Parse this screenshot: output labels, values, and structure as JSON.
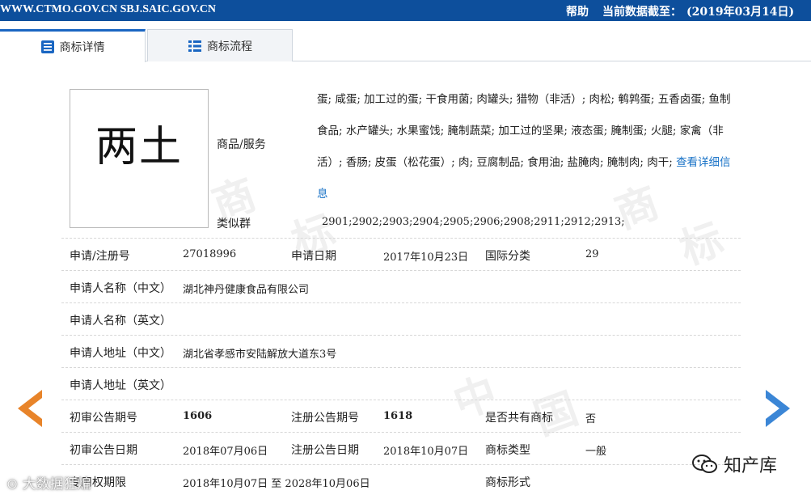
{
  "topbar": {
    "site": "WWW.CTMO.GOV.CN SBJ.SAIC.GOV.CN",
    "help": "帮助",
    "asof_label": "当前数据截至：",
    "asof_date": "(2019年03月14日)"
  },
  "tabs": [
    {
      "label": "商标详情",
      "icon": "document-icon",
      "active": true
    },
    {
      "label": "商标流程",
      "icon": "list-icon",
      "active": false
    }
  ],
  "trademark": {
    "logo_text": "两土",
    "goods_label": "商品/服务",
    "goods_text": "蛋; 咸蛋; 加工过的蛋; 干食用菌; 肉罐头; 猎物（非活）; 肉松; 鹌鹑蛋; 五香卤蛋; 鱼制食品; 水产罐头; 水果蜜饯; 腌制蔬菜; 加工过的坚果; 液态蛋; 腌制蛋; 火腿; 家禽（非活）; 香肠; 皮蛋（松花蛋）; 肉; 豆腐制品; 食用油; 盐腌肉; 腌制肉; 肉干; ",
    "goods_more": "查看详细信息",
    "similar_label": "类似群",
    "similar_value": "2901;2902;2903;2904;2905;2906;2908;2911;2912;2913;"
  },
  "fields": {
    "reg_no_label": "申请/注册号",
    "reg_no": "27018996",
    "apply_date_label": "申请日期",
    "apply_date": "2017年10月23日",
    "intl_class_label": "国际分类",
    "intl_class": "29",
    "applicant_cn_label": "申请人名称（中文）",
    "applicant_cn": "湖北神丹健康食品有限公司",
    "applicant_en_label": "申请人名称（英文）",
    "applicant_en": "",
    "address_cn_label": "申请人地址（中文）",
    "address_cn": "湖北省孝感市安陆解放大道东3号",
    "address_en_label": "申请人地址（英文）",
    "address_en": "",
    "prelim_no_label": "初审公告期号",
    "prelim_no": "1606",
    "reg_pub_no_label": "注册公告期号",
    "reg_pub_no": "1618",
    "shared_label": "是否共有商标",
    "shared": "否",
    "prelim_date_label": "初审公告日期",
    "prelim_date": "2018年07月06日",
    "reg_pub_date_label": "注册公告日期",
    "reg_pub_date": "2018年10月07日",
    "tm_type_label": "商标类型",
    "tm_type": "一般",
    "term_label": "专用权期限",
    "term": "2018年10月07日 至 2028年10月06日",
    "tm_form_label": "商标形式",
    "tm_form": ""
  },
  "watermark": {
    "chars": [
      "商",
      "标",
      "中",
      "国",
      "商",
      "标"
    ]
  },
  "footer": {
    "left_text": "大数据狂煸",
    "right_text": "知产库"
  },
  "colors": {
    "topbar": "#0d4f9c",
    "accent": "#1a66c2",
    "arrow_left": "#e8842a",
    "arrow_right": "#3b86d6",
    "link": "#1a73c7"
  }
}
